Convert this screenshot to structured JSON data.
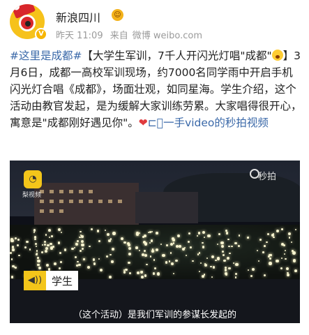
{
  "header": {
    "account_name": "新浪四川",
    "time": "昨天 11:09",
    "source_prefix": "来自",
    "source": "微博 weibo.com",
    "vip_icon": "vip-smiley-icon",
    "verified_icon": "verified-badge-icon"
  },
  "post": {
    "hashtag": "#这里是成都#",
    "title_part1": "【大学生军训，7千人开闪光灯唱\"成都\"",
    "title_part2": "】3月6日，成都一高校军训现场，约7000名同学雨中开启手机闪光灯合唱《成都》，场面壮观，如同星海。学生介绍，这个活动由教官发起，是为缓解大家训练劳累。大家唱得很开心，寓意是\"成都刚好遇见你\"。",
    "video_link": "一手video的秒拍视频",
    "video_link_icon": "video-icon",
    "accent_color": "#eb7350",
    "link_color": "#3a68a8"
  },
  "video": {
    "logo_text": "梨视频",
    "watermark": "秒拍",
    "badge_label": "学生",
    "subtitle": "（这个活动）是我们军训的参谋长发起的"
  }
}
